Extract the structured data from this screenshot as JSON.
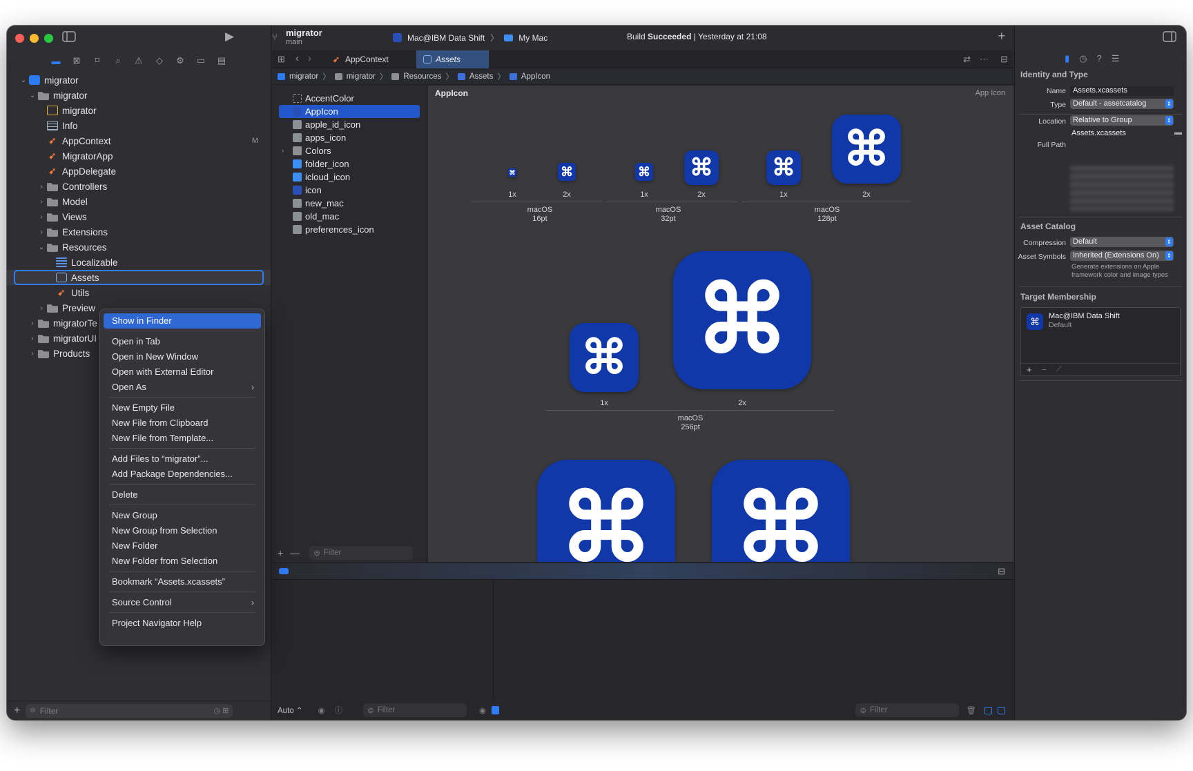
{
  "toolbar": {
    "project_name": "migrator",
    "branch": "main",
    "scheme": "Mac@IBM Data Shift",
    "destination": "My Mac",
    "status_prefix": "Build",
    "status_bold": "Succeeded",
    "status_suffix": "| Yesterday at 21:08"
  },
  "tabs": [
    {
      "label": "AppContext"
    },
    {
      "label": "Assets"
    }
  ],
  "jumpbar": [
    "migrator",
    "migrator",
    "Resources",
    "Assets",
    "AppIcon"
  ],
  "navigator": {
    "items": [
      {
        "label": "migrator",
        "depth": 0,
        "chev": "v",
        "icon": "app"
      },
      {
        "label": "migrator",
        "depth": 1,
        "chev": "v",
        "icon": "folder"
      },
      {
        "label": "migrator",
        "depth": 2,
        "chev": "",
        "icon": "yellow"
      },
      {
        "label": "Info",
        "depth": 2,
        "chev": "",
        "icon": "table"
      },
      {
        "label": "AppContext",
        "depth": 2,
        "chev": "",
        "icon": "swift",
        "badge": "M"
      },
      {
        "label": "MigratorApp",
        "depth": 2,
        "chev": "",
        "icon": "swift"
      },
      {
        "label": "AppDelegate",
        "depth": 2,
        "chev": "",
        "icon": "swift"
      },
      {
        "label": "Controllers",
        "depth": 2,
        "chev": ">",
        "icon": "folder"
      },
      {
        "label": "Model",
        "depth": 2,
        "chev": ">",
        "icon": "folder"
      },
      {
        "label": "Views",
        "depth": 2,
        "chev": ">",
        "icon": "folder"
      },
      {
        "label": "Extensions",
        "depth": 2,
        "chev": ">",
        "icon": "folder"
      },
      {
        "label": "Resources",
        "depth": 2,
        "chev": "v",
        "icon": "folder"
      },
      {
        "label": "Localizable",
        "depth": 3,
        "chev": "",
        "icon": "loc"
      },
      {
        "label": "Assets",
        "depth": 3,
        "chev": "",
        "icon": "assets",
        "selected": true
      },
      {
        "label": "Utils",
        "depth": 3,
        "chev": "",
        "icon": "swift"
      },
      {
        "label": "Preview",
        "depth": 2,
        "chev": ">",
        "icon": "folder"
      },
      {
        "label": "migratorTe",
        "depth": 1,
        "chev": ">",
        "icon": "folder"
      },
      {
        "label": "migratorUI",
        "depth": 1,
        "chev": ">",
        "icon": "folder"
      },
      {
        "label": "Products",
        "depth": 1,
        "chev": ">",
        "icon": "folder"
      }
    ],
    "filter_placeholder": "Filter"
  },
  "context_menu": [
    {
      "label": "Show in Finder",
      "highlight": true
    },
    {
      "sep": true
    },
    {
      "label": "Open in Tab"
    },
    {
      "label": "Open in New Window"
    },
    {
      "label": "Open with External Editor"
    },
    {
      "label": "Open As",
      "submenu": true
    },
    {
      "sep": true
    },
    {
      "label": "New Empty File"
    },
    {
      "label": "New File from Clipboard"
    },
    {
      "label": "New File from Template..."
    },
    {
      "sep": true
    },
    {
      "label": "Add Files to “migrator”..."
    },
    {
      "label": "Add Package Dependencies..."
    },
    {
      "sep": true
    },
    {
      "label": "Delete"
    },
    {
      "sep": true
    },
    {
      "label": "New Group"
    },
    {
      "label": "New Group from Selection"
    },
    {
      "label": "New Folder"
    },
    {
      "label": "New Folder from Selection"
    },
    {
      "sep": true
    },
    {
      "label": "Bookmark “Assets.xcassets”"
    },
    {
      "sep": true
    },
    {
      "label": "Source Control",
      "submenu": true
    },
    {
      "sep": true
    },
    {
      "label": "Project Navigator Help"
    }
  ],
  "asset_list": {
    "items": [
      {
        "label": "AccentColor",
        "icon": "color"
      },
      {
        "label": "AppIcon",
        "icon": "appicon",
        "selected": true
      },
      {
        "label": "apple_id_icon",
        "icon": "image"
      },
      {
        "label": "apps_icon",
        "icon": "image"
      },
      {
        "label": "Colors",
        "icon": "folder",
        "chev": ">"
      },
      {
        "label": "folder_icon",
        "icon": "blue"
      },
      {
        "label": "icloud_icon",
        "icon": "blue"
      },
      {
        "label": "icon",
        "icon": "appicon"
      },
      {
        "label": "new_mac",
        "icon": "image"
      },
      {
        "label": "old_mac",
        "icon": "image"
      },
      {
        "label": "preferences_icon",
        "icon": "image"
      }
    ],
    "filter_placeholder": "Filter"
  },
  "canvas": {
    "title": "AppIcon",
    "subtitle": "App Icon",
    "scale_1x": "1x",
    "scale_2x": "2x",
    "groups": [
      {
        "os": "macOS",
        "size": "16pt"
      },
      {
        "os": "macOS",
        "size": "32pt"
      },
      {
        "os": "macOS",
        "size": "128pt"
      },
      {
        "os": "macOS",
        "size": "256pt"
      }
    ],
    "icon_glyph": "⌘",
    "icon_color": "#1038a8"
  },
  "debug": {
    "auto_label": "Auto ⌃",
    "filter_left": "Filter",
    "filter_mid": "Filter",
    "filter_right": "Filter"
  },
  "inspector": {
    "identity_title": "Identity and Type",
    "name_label": "Name",
    "name_value": "Assets.xcassets",
    "type_label": "Type",
    "type_value": "Default - assetcatalog",
    "location_label": "Location",
    "location_value": "Relative to Group",
    "location_file": "Assets.xcassets",
    "fullpath_label": "Full Path",
    "catalog_title": "Asset Catalog",
    "compression_label": "Compression",
    "compression_value": "Default",
    "symbols_label": "Asset Symbols",
    "symbols_value": "Inherited (Extensions On)",
    "symbols_note": "Generate extensions on Apple framework color and image types",
    "membership_title": "Target Membership",
    "target_name": "Mac@IBM Data Shift",
    "target_sub": "Default"
  },
  "colors": {
    "accent": "#2f7cf6",
    "selection": "#2256c9",
    "menu_highlight": "#2f67d4"
  }
}
